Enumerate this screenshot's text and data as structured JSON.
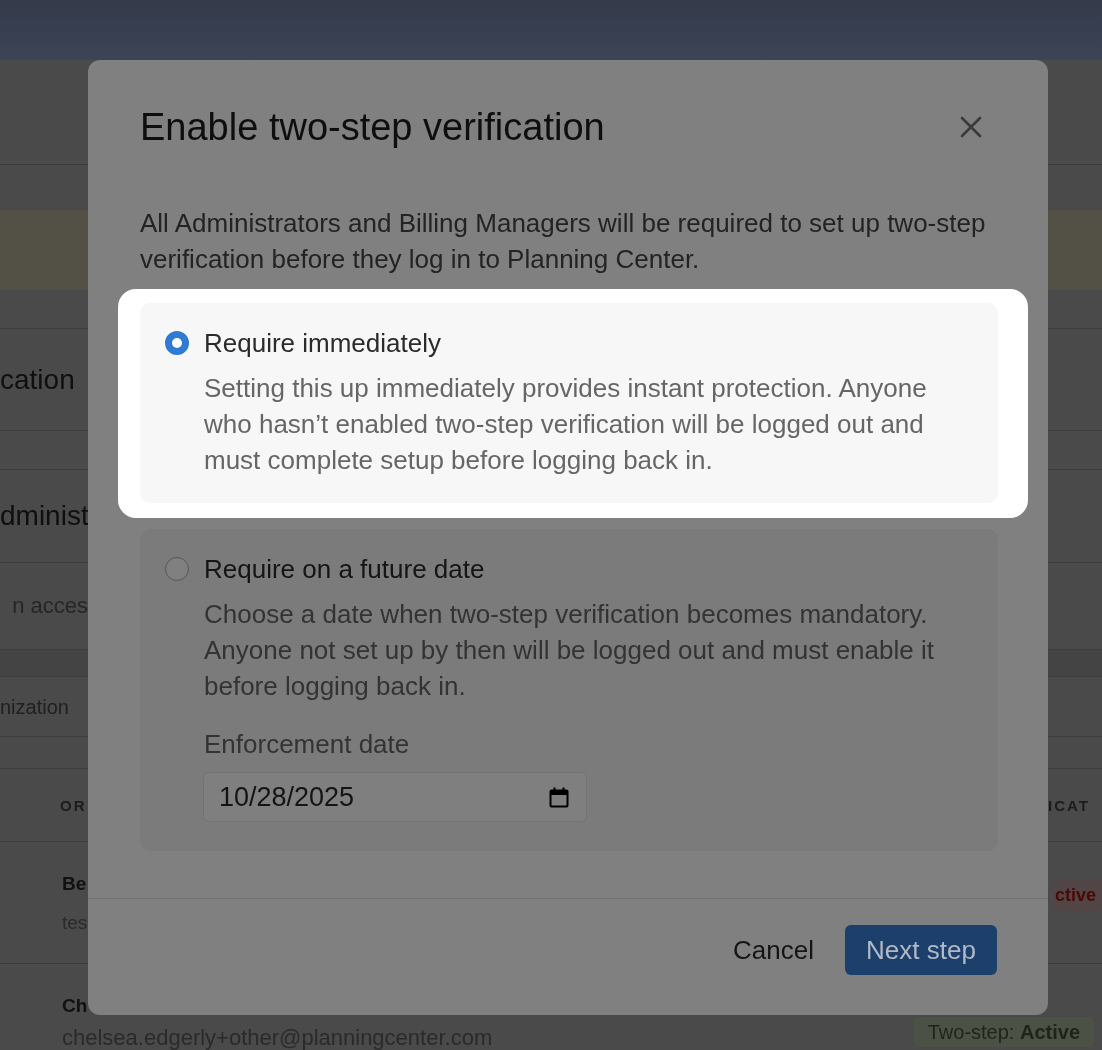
{
  "page_behind": {
    "section_heading_1": "cation",
    "section_heading_2": "dminist",
    "section_description": "n acces",
    "hint": "nization",
    "table": {
      "columns": [
        "OR",
        "ICAT"
      ],
      "rows": [
        {
          "name": "Be",
          "email": "tes",
          "status": "ctive",
          "kind": "inactive"
        },
        {
          "name": "Ch",
          "email": "chelsea.edgerly+other@planningcenter.com",
          "status": "Two-step: **Active**",
          "kind": "active"
        }
      ]
    }
  },
  "dialog": {
    "title": "Enable two-step verification",
    "intro": "All Administrators and Billing Managers will be required to set up two-step verification before they log in to Planning Center.",
    "options": [
      {
        "label": "Require immediately",
        "description": "Setting this up immediately provides instant protection. Anyone who hasn’t enabled two-step verification will be logged out and must complete setup before logging back in.",
        "selected": true,
        "highlighted": true
      },
      {
        "label": "Require on a future date",
        "description": "Choose a date when two-step verification becomes mandatory. Anyone not set up by then will be logged out and must enable it before logging back in.",
        "selected": false,
        "highlighted": false,
        "date_field": {
          "label": "Enforcement date",
          "value": "10/28/2025"
        }
      }
    ],
    "buttons": [
      {
        "label": "Cancel",
        "kind": "secondary"
      },
      {
        "label": "Next step",
        "kind": "primary"
      }
    ]
  }
}
